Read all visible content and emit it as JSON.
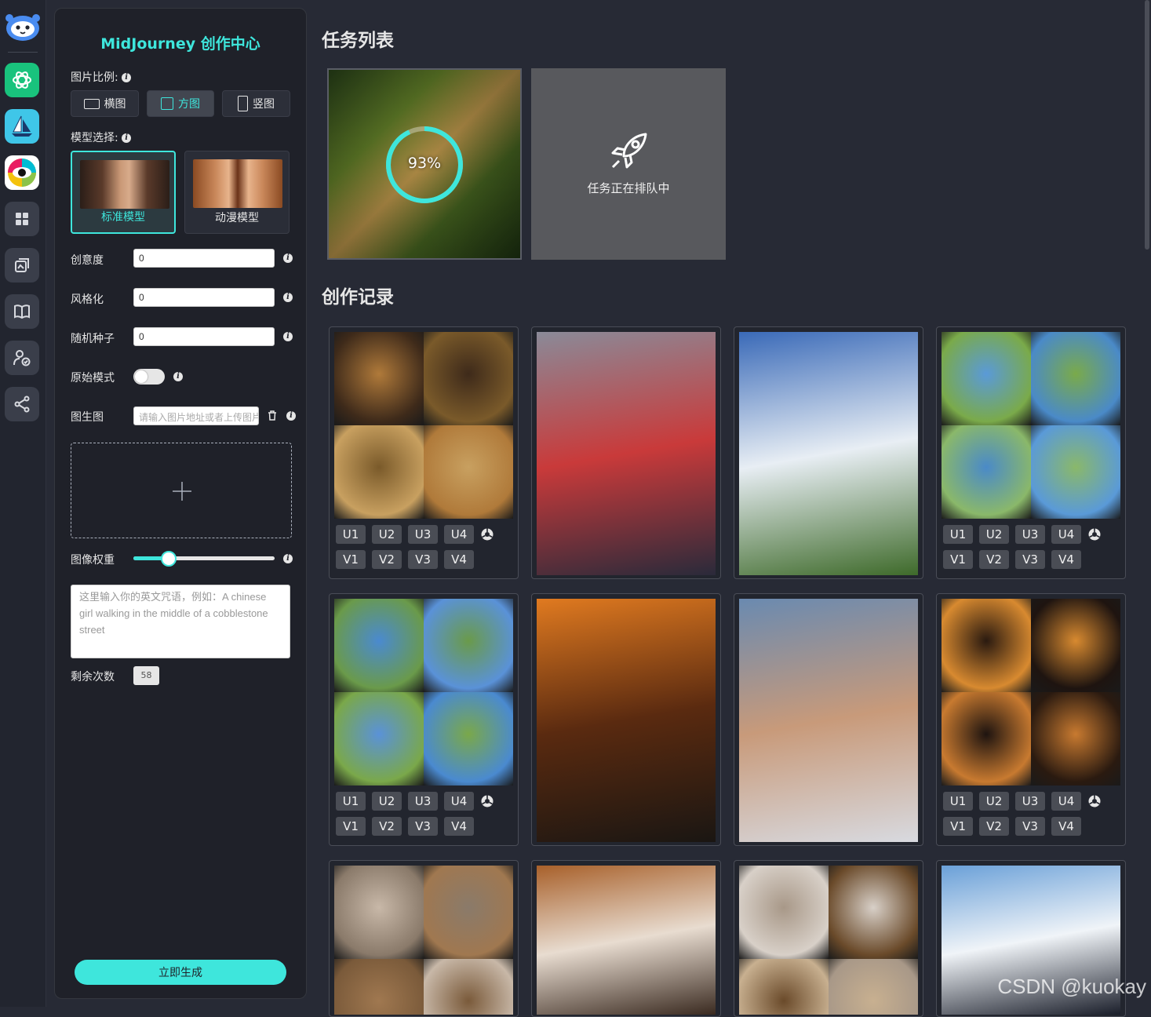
{
  "panel": {
    "title": "MidJourney 创作中心",
    "ratio_label": "图片比例:",
    "ratios": [
      "横图",
      "方图",
      "竖图"
    ],
    "ratio_selected": "方图",
    "model_label": "模型选择:",
    "models": [
      "标准模型",
      "动漫模型"
    ],
    "model_selected": "标准模型",
    "creativity_label": "创意度",
    "creativity_value": "0",
    "stylize_label": "风格化",
    "stylize_value": "0",
    "seed_label": "随机种子",
    "seed_value": "0",
    "raw_label": "原始模式",
    "raw_enabled": false,
    "img2img_label": "图生图",
    "img2img_placeholder": "请输入图片地址或者上传图片",
    "weight_label": "图像权重",
    "weight_fraction": 0.25,
    "prompt_placeholder": "这里输入你的英文咒语，例如：A chinese girl walking in the middle of a cobblestone street",
    "remaining_label": "剩余次数",
    "remaining_value": "58",
    "generate_label": "立即生成"
  },
  "main": {
    "tasks_title": "任务列表",
    "progress_label": "93%",
    "progress_fraction": 0.93,
    "queued_text": "任务正在排队中",
    "records_title": "创作记录",
    "upscale_labels": [
      "U1",
      "U2",
      "U3",
      "U4"
    ],
    "variation_labels": [
      "V1",
      "V2",
      "V3",
      "V4"
    ],
    "watermark": "CSDN @kuokay"
  },
  "colors": {
    "accent": "#3ee6dc",
    "background": "#272a35",
    "panel": "#1f2129"
  },
  "icons": [
    "assistant-logo-icon",
    "chatgpt-icon",
    "midjourney-icon",
    "eye-art-icon",
    "grid-apps-icon",
    "gallery-icon",
    "book-icon",
    "user-settings-icon",
    "share-icon",
    "info-icon",
    "trash-icon",
    "plus-icon",
    "rocket-icon",
    "reroll-icon"
  ]
}
